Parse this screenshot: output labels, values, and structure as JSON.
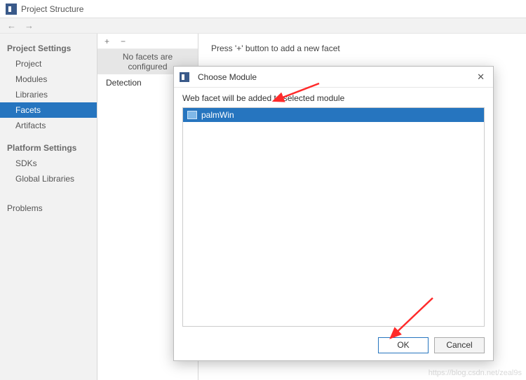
{
  "window": {
    "title": "Project Structure"
  },
  "nav": {
    "back": "←",
    "forward": "→"
  },
  "sidebar": {
    "section1": "Project Settings",
    "items1": [
      "Project",
      "Modules",
      "Libraries",
      "Facets",
      "Artifacts"
    ],
    "section2": "Platform Settings",
    "items2": [
      "SDKs",
      "Global Libraries"
    ],
    "section3_item": "Problems"
  },
  "centerColumn": {
    "plus": "+",
    "minus": "−",
    "banner": "No facets are configured",
    "items": [
      "Detection"
    ]
  },
  "rightPanel": {
    "hint": "Press '+' button to add a new facet"
  },
  "dialog": {
    "title": "Choose Module",
    "close": "✕",
    "message": "Web facet will be added to selected module",
    "modules": [
      "palmWin"
    ],
    "ok": "OK",
    "cancel": "Cancel"
  },
  "watermark": "https://blog.csdn.net/zeal9s"
}
